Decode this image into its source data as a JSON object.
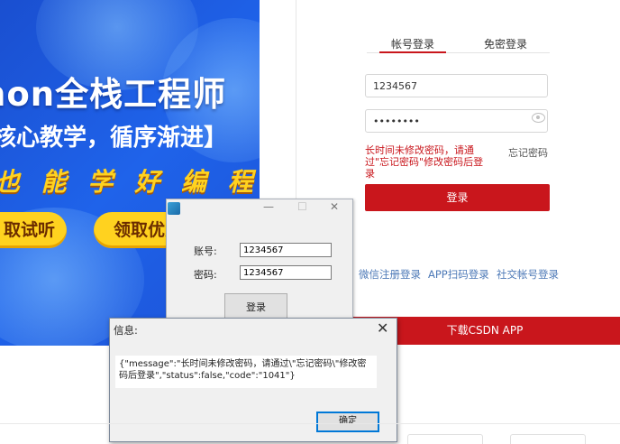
{
  "banner": {
    "title": "hon全栈工程师",
    "subtitle": "核心教学，循序渐进】",
    "slogan": "也 能 学 好 编 程",
    "buttons": [
      "取试听",
      "领取优惠"
    ]
  },
  "login_panel": {
    "tabs": [
      {
        "label": "帐号登录",
        "active": true
      },
      {
        "label": "免密登录",
        "active": false
      }
    ],
    "account_value": "1234567",
    "password_value": "••••••••",
    "error_text": "长时间未修改密码，请通过\"忘记密码\"修改密码后登录",
    "forgot_label": "忘记密码",
    "login_button": "登录",
    "links": [
      "微信注册登录",
      "APP扫码登录",
      "社交帐号登录"
    ],
    "download_button": "下载CSDN APP"
  },
  "login_window": {
    "controls": {
      "minimize": "—",
      "maximize": "☐",
      "close": "✕"
    },
    "account_label": "账号:",
    "account_value": "1234567",
    "password_label": "密码:",
    "password_value": "1234567",
    "login_button": "登录"
  },
  "message_box": {
    "title": "信息:",
    "close": "✕",
    "message": "{\"message\":\"长时间未修改密码，请通过\\\"忘记密码\\\"修改密码后登录\",\"status\":false,\"code\":\"1041\"}",
    "ok_button": "确定"
  },
  "colors": {
    "accent_red": "#c9161c",
    "banner_blue": "#1f63ea",
    "banner_yellow": "#ffd21f",
    "link_blue": "#4d79b7"
  },
  "icons": [
    "eye-icon",
    "app-logo-icon"
  ]
}
